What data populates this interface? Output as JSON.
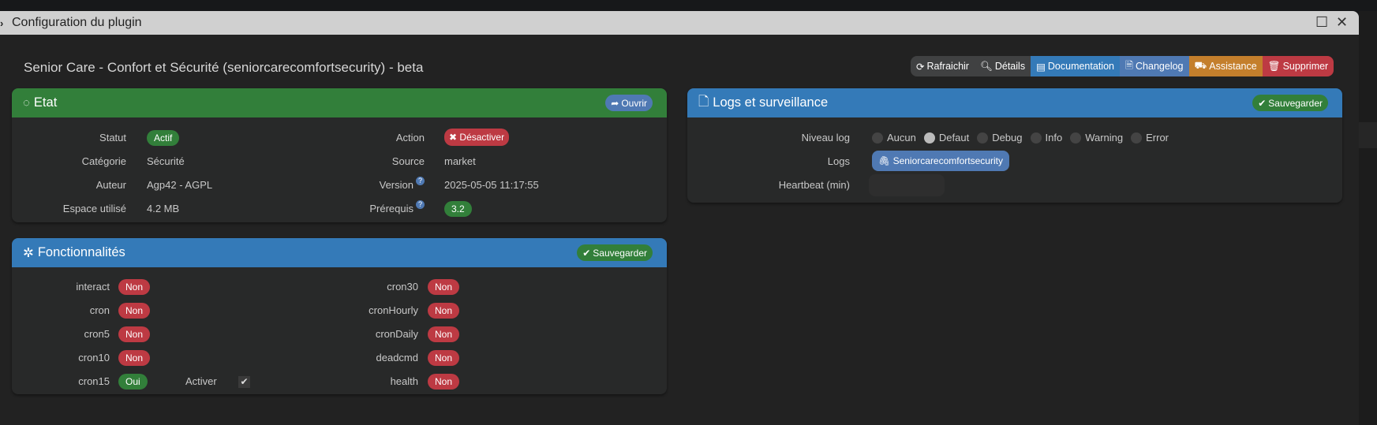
{
  "window": {
    "title": "Configuration du plugin"
  },
  "heading": "Senior Care - Confort et Sécurité (seniorcarecomfortsecurity) - beta",
  "toolbar": [
    {
      "label": "Rafraichir",
      "icon": "refresh-icon",
      "color": "#404142"
    },
    {
      "label": "Détails",
      "icon": "search-icon",
      "color": "#404142"
    },
    {
      "label": "Documentation",
      "icon": "book-icon",
      "color": "#347ab8"
    },
    {
      "label": "Changelog",
      "icon": "file-code-icon",
      "color": "#4f79b3"
    },
    {
      "label": "Assistance",
      "icon": "ambulance-icon",
      "color": "#c47f2c"
    },
    {
      "label": "Supprimer",
      "icon": "trash-icon",
      "color": "#bd3a43"
    }
  ],
  "etat": {
    "title": "Etat",
    "open_label": "Ouvrir",
    "statut_label": "Statut",
    "statut": "Actif",
    "categorie_label": "Catégorie",
    "categorie": "Sécurité",
    "auteur_label": "Auteur",
    "auteur": "Agp42 - AGPL",
    "espace_label": "Espace utilisé",
    "espace": "4.2 MB",
    "action_label": "Action",
    "action": "Désactiver",
    "source_label": "Source",
    "source": "market",
    "version_label": "Version",
    "version": "2025-05-05 11:17:55",
    "prerequis_label": "Prérequis",
    "prerequis": "3.2"
  },
  "fonctionnalites": {
    "title": "Fonctionnalités",
    "save_label": "Sauvegarder",
    "left": [
      {
        "name": "interact",
        "value": "Non"
      },
      {
        "name": "cron",
        "value": "Non"
      },
      {
        "name": "cron5",
        "value": "Non"
      },
      {
        "name": "cron10",
        "value": "Non"
      },
      {
        "name": "cron15",
        "value": "Oui"
      }
    ],
    "right": [
      {
        "name": "cron30",
        "value": "Non"
      },
      {
        "name": "cronHourly",
        "value": "Non"
      },
      {
        "name": "cronDaily",
        "value": "Non"
      },
      {
        "name": "deadcmd",
        "value": "Non"
      },
      {
        "name": "health",
        "value": "Non"
      }
    ],
    "activer_label": "Activer",
    "activer_checked": true
  },
  "logs": {
    "title": "Logs et surveillance",
    "save_label": "Sauvegarder",
    "niveau_label": "Niveau log",
    "levels": [
      "Aucun",
      "Defaut",
      "Debug",
      "Info",
      "Warning",
      "Error"
    ],
    "selected": "Defaut",
    "logs_label": "Logs",
    "log_button": "Seniorcarecomfortsecurity",
    "heartbeat_label": "Heartbeat (min)",
    "heartbeat_value": ""
  }
}
